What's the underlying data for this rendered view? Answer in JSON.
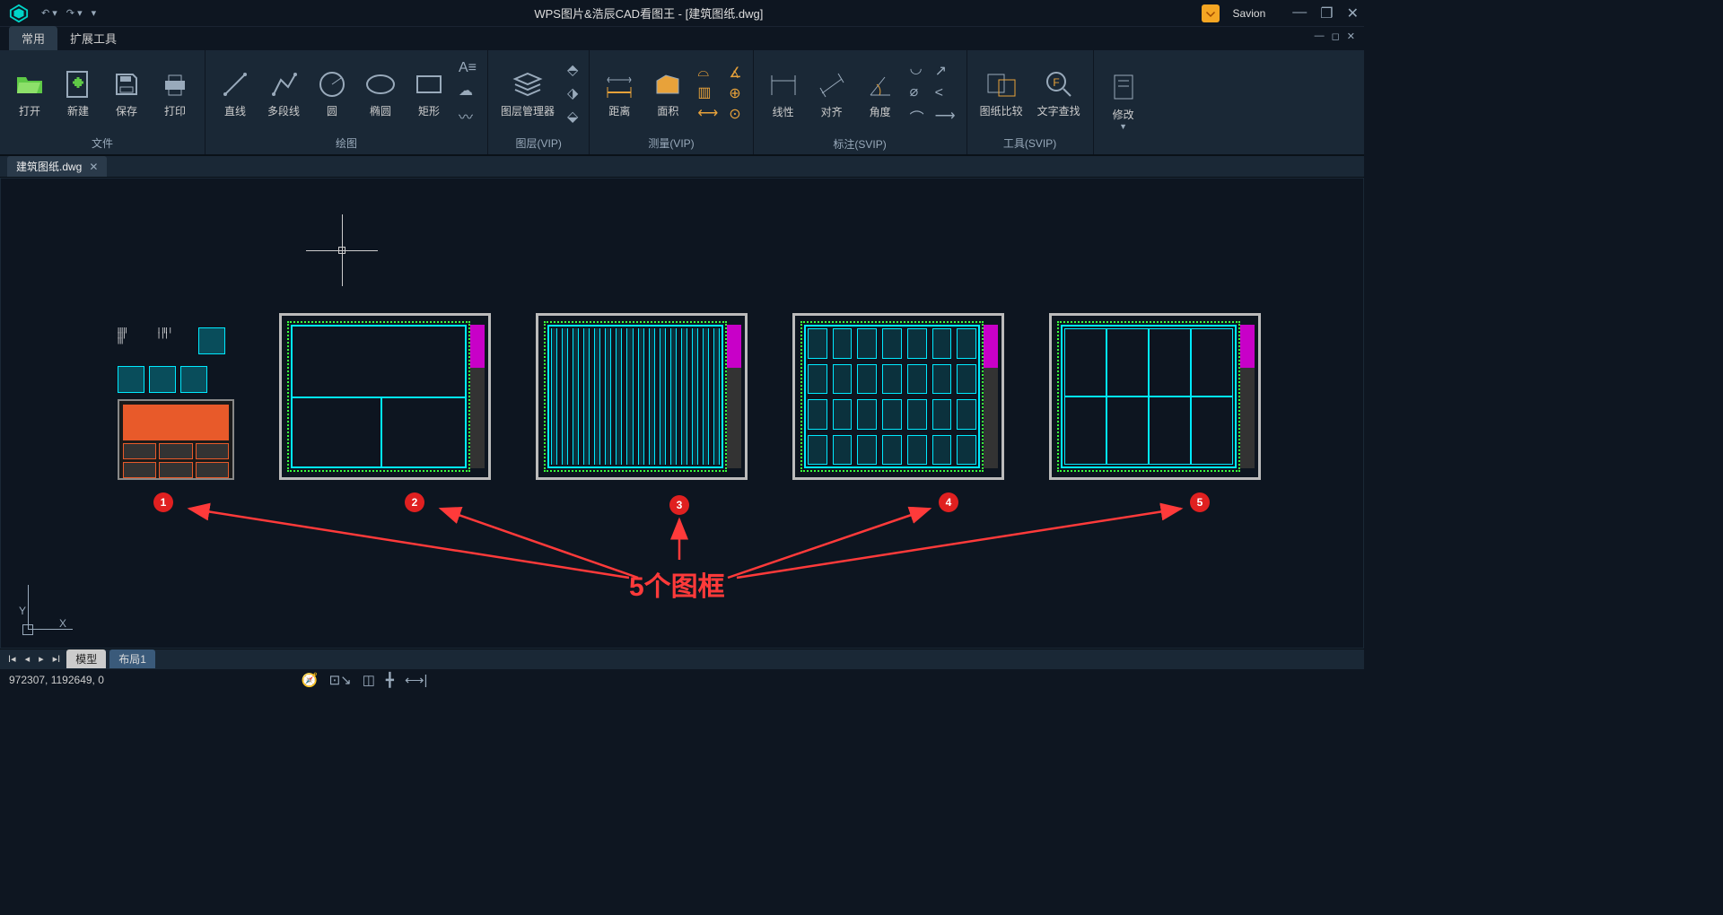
{
  "titlebar": {
    "title": "WPS图片&浩辰CAD看图王 - [建筑图纸.dwg]",
    "user_name": "Savion"
  },
  "menu": {
    "tabs": [
      "常用",
      "扩展工具"
    ]
  },
  "ribbon": {
    "file": {
      "title": "文件",
      "open": "打开",
      "new": "新建",
      "save": "保存",
      "print": "打印"
    },
    "draw": {
      "title": "绘图",
      "line": "直线",
      "polyline": "多段线",
      "circle": "圆",
      "ellipse": "椭圆",
      "rect": "矩形"
    },
    "layer": {
      "title": "图层(VIP)",
      "manager": "图层管理器"
    },
    "measure": {
      "title": "测量(VIP)",
      "distance": "距离",
      "area": "面积"
    },
    "dimension": {
      "title": "标注(SVIP)",
      "linear": "线性",
      "aligned": "对齐",
      "angular": "角度"
    },
    "tools": {
      "title": "工具(SVIP)",
      "compare": "图纸比较",
      "findtext": "文字查找"
    },
    "modify": {
      "title": "",
      "modify": "修改"
    }
  },
  "doc_tab": {
    "name": "建筑图纸.dwg"
  },
  "annotations": {
    "badges": [
      "1",
      "2",
      "3",
      "4",
      "5"
    ],
    "label": "5个图框"
  },
  "ucs": {
    "x": "X",
    "y": "Y"
  },
  "layout": {
    "tabs": [
      "模型",
      "布局1"
    ]
  },
  "statusbar": {
    "coords": "972307, 1192649, 0"
  }
}
